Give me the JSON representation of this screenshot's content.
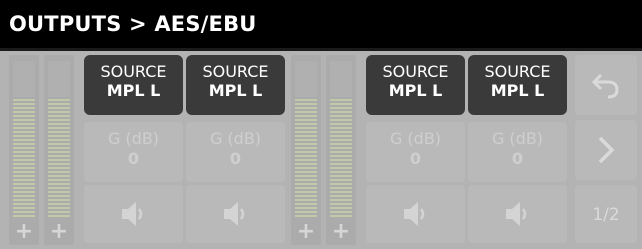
{
  "title": "OUTPUTS > AES/EBU",
  "meters": [
    {
      "plus": "+"
    },
    {
      "plus": "+"
    },
    {
      "plus": "+"
    },
    {
      "plus": "+"
    }
  ],
  "channels": [
    {
      "source_label": "SOURCE",
      "source_value": "MPL L",
      "gain_label": "G (dB)",
      "gain_value": "0"
    },
    {
      "source_label": "SOURCE",
      "source_value": "MPL L",
      "gain_label": "G (dB)",
      "gain_value": "0"
    },
    {
      "source_label": "SOURCE",
      "source_value": "MPL L",
      "gain_label": "G (dB)",
      "gain_value": "0"
    },
    {
      "source_label": "SOURCE",
      "source_value": "MPL L",
      "gain_label": "G (dB)",
      "gain_value": "0"
    }
  ],
  "nav": {
    "back_icon": "undo-icon",
    "next_icon": "chevron-right-icon",
    "page": "1/2"
  },
  "colors": {
    "title_bg": "#000000",
    "source_button_bg": "#3a3a3a",
    "panel_bg": "#b3b3b3",
    "meter_green": "#c4d0a8"
  }
}
